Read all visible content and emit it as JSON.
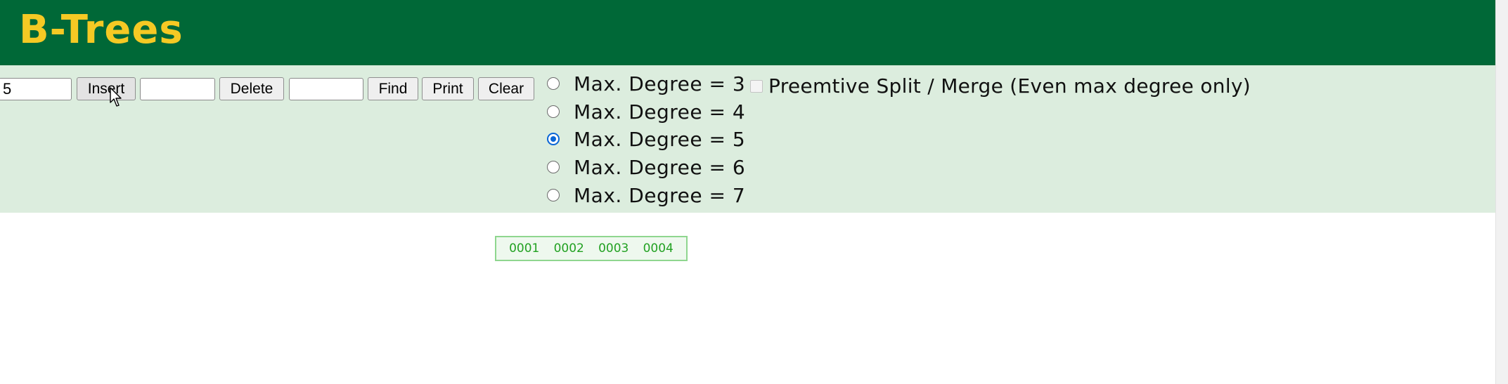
{
  "header": {
    "title": "B-Trees"
  },
  "toolbar": {
    "insert_value": "5",
    "insert_label": "Insert",
    "delete_value": "",
    "delete_label": "Delete",
    "find_value": "",
    "find_label": "Find",
    "print_label": "Print",
    "clear_label": "Clear"
  },
  "degree_options": [
    {
      "label": "Max. Degree = 3",
      "checked": false
    },
    {
      "label": "Max. Degree = 4",
      "checked": false
    },
    {
      "label": "Max. Degree = 5",
      "checked": true
    },
    {
      "label": "Max. Degree = 6",
      "checked": false
    },
    {
      "label": "Max. Degree = 7",
      "checked": false
    }
  ],
  "preemptive": {
    "label": "Preemtive Split / Merge (Even max degree only)",
    "checked": false
  },
  "tree": {
    "root_keys": [
      "0001",
      "0002",
      "0003",
      "0004"
    ]
  },
  "colors": {
    "header_bg": "#006837",
    "title": "#f5c924",
    "controls_bg": "#dcedde",
    "node_border": "#8fd68f",
    "node_key": "#22a122",
    "radio_accent": "#0b66d6"
  },
  "icons": [
    "mouse-cursor-icon"
  ]
}
